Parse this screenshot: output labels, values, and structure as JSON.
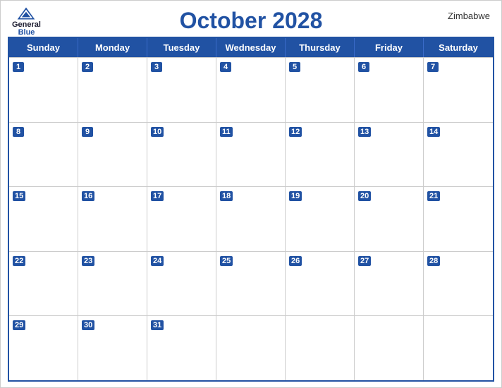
{
  "header": {
    "title": "October 2028",
    "country": "Zimbabwe",
    "logo": {
      "general": "General",
      "blue": "Blue"
    }
  },
  "weekdays": [
    "Sunday",
    "Monday",
    "Tuesday",
    "Wednesday",
    "Thursday",
    "Friday",
    "Saturday"
  ],
  "weeks": [
    [
      {
        "day": 1,
        "empty": false
      },
      {
        "day": 2,
        "empty": false
      },
      {
        "day": 3,
        "empty": false
      },
      {
        "day": 4,
        "empty": false
      },
      {
        "day": 5,
        "empty": false
      },
      {
        "day": 6,
        "empty": false
      },
      {
        "day": 7,
        "empty": false
      }
    ],
    [
      {
        "day": 8,
        "empty": false
      },
      {
        "day": 9,
        "empty": false
      },
      {
        "day": 10,
        "empty": false
      },
      {
        "day": 11,
        "empty": false
      },
      {
        "day": 12,
        "empty": false
      },
      {
        "day": 13,
        "empty": false
      },
      {
        "day": 14,
        "empty": false
      }
    ],
    [
      {
        "day": 15,
        "empty": false
      },
      {
        "day": 16,
        "empty": false
      },
      {
        "day": 17,
        "empty": false
      },
      {
        "day": 18,
        "empty": false
      },
      {
        "day": 19,
        "empty": false
      },
      {
        "day": 20,
        "empty": false
      },
      {
        "day": 21,
        "empty": false
      }
    ],
    [
      {
        "day": 22,
        "empty": false
      },
      {
        "day": 23,
        "empty": false
      },
      {
        "day": 24,
        "empty": false
      },
      {
        "day": 25,
        "empty": false
      },
      {
        "day": 26,
        "empty": false
      },
      {
        "day": 27,
        "empty": false
      },
      {
        "day": 28,
        "empty": false
      }
    ],
    [
      {
        "day": 29,
        "empty": false
      },
      {
        "day": 30,
        "empty": false
      },
      {
        "day": 31,
        "empty": false
      },
      {
        "day": null,
        "empty": true
      },
      {
        "day": null,
        "empty": true
      },
      {
        "day": null,
        "empty": true
      },
      {
        "day": null,
        "empty": true
      }
    ]
  ]
}
